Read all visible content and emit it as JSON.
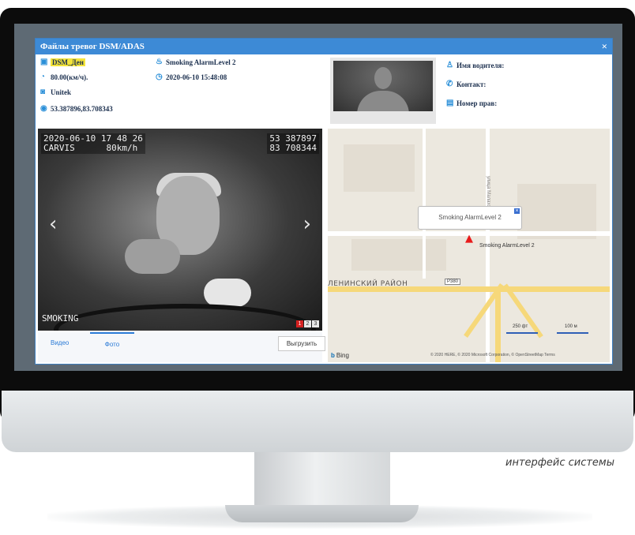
{
  "window": {
    "title": "Файлы тревог DSM/ADAS",
    "close_label": "×"
  },
  "info": {
    "event_type": "DSM_Ден",
    "speed": "80.00(км/ч).",
    "company": "Unitek",
    "coordinates": "53.387896,83.708343",
    "alarm": "Smoking AlarmLevel 2",
    "datetime": "2020-06-10 15:48:08"
  },
  "driver": {
    "name_label": "Имя водителя:",
    "contact_label": "Контакт:",
    "license_label": "Номер прав:"
  },
  "photo": {
    "osd_datetime": "2020-06-10 17 48 26",
    "osd_device": "CARVIS",
    "osd_speed": "80km/h",
    "osd_lat": "53 387897",
    "osd_lon": "83 708344",
    "osd_event": "SMOKING",
    "prev_label": "‹",
    "next_label": "›",
    "pages": [
      "1",
      "2",
      "3"
    ],
    "active_page": "1"
  },
  "tabs": {
    "video": "Видео",
    "photo": "Фото",
    "export": "Выгрузить"
  },
  "map": {
    "popup_text": "Smoking AlarmLevel 2",
    "marker_label": "Smoking AlarmLevel 2",
    "district": "ЛЕНИНСКИЙ РАЙОН",
    "road_shield": "Р380",
    "street": "улица Малахова",
    "scale_ft": "250 фт",
    "scale_m": "100 м",
    "provider": "Bing",
    "copyright": "© 2020 HERE, © 2020 Microsoft Corporation, © OpenStreetMap  Terms"
  },
  "caption": "интерфейс системы",
  "colors": {
    "titlebar": "#3d8ad6",
    "highlight": "#f4e43a",
    "alarm_marker": "#e81b1b",
    "active_page": "#d42020"
  }
}
